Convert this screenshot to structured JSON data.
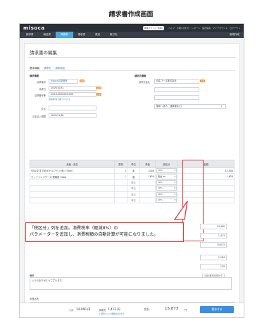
{
  "caption": "請求書作成画面",
  "app": {
    "logo": "misoca"
  },
  "topbar": {
    "period": "通常プラン(ご利用)",
    "links": [
      "ヘルプ",
      "お問い合わせ",
      "レポート",
      "設定情報",
      "マイアカウント",
      "ログアウト"
    ]
  },
  "nav": {
    "items": [
      "請求書",
      "納品書",
      "見積書",
      "領収書",
      "発送",
      "取引先"
    ],
    "active_index": 2,
    "right": "新規作成"
  },
  "page": {
    "title": "請求書の編集"
  },
  "tabs": [
    "基本情報",
    "請求先",
    "請求設定"
  ],
  "left": {
    "section": "請求情報",
    "invoice_no_label": "請求番号",
    "invoice_no_value": "Misoca請求番号",
    "invoice_date_label": "請求日",
    "invoice_date_value": "2019/10/31",
    "invoice_code_label": "請求番号等",
    "invoice_code_value": "XXX-XXXXXXXX-XXX",
    "code_note": "請求番号を自動で入力する",
    "subject_label": "件名",
    "subject_value": "",
    "due_label": "お支払い期限",
    "due_value": "2019/11/30",
    "required": "必須"
  },
  "right": {
    "section": "請求先情報",
    "client_label": "請求先会社",
    "client_value": "弥生フーズ株式会社",
    "dept_placeholder": "",
    "person_placeholder": "",
    "honorific_value": "御中（法人、団体様など）"
  },
  "table": {
    "headers": [
      "品番・品名",
      "数量",
      "単位",
      "単価",
      "税区分",
      "金額"
    ],
    "rows": [
      {
        "name": "9月のおすすめボトルワイン(赤) 750ml",
        "qty": "3",
        "unit": "本",
        "price": "4300",
        "tax": "10%",
        "amount": "12,900"
      },
      {
        "name": "モッツァレラチーズ 業務用 500g",
        "qty": "1",
        "unit": "個",
        "price": "1620",
        "tax": "軽減 8%",
        "amount": "1,620"
      },
      {
        "name": "",
        "qty": "",
        "unit": "単位",
        "price": "",
        "tax": "10%",
        "amount": "15,873"
      },
      {
        "name": "",
        "qty": "",
        "unit": "単位",
        "price": "",
        "tax": "10%",
        "amount": ""
      },
      {
        "name": "",
        "qty": "",
        "unit": "単位",
        "price": "",
        "tax": "10%",
        "amount": ""
      },
      {
        "name": "",
        "qty": "",
        "unit": "単位",
        "price": "",
        "tax": "10%",
        "amount": ""
      }
    ],
    "add_row": "行を追加（最大80行まで）"
  },
  "summary": {
    "subtotal": "14,460",
    "tax": "1,413",
    "total": "15,873",
    "label_tax": "消費税",
    "sub_a": "1,284",
    "sub_b": "129"
  },
  "callout": {
    "line1": "「税区分」列を追加。消費税率（軽減8%）の",
    "line2": "パラメーターを追加し、消費税額の自動計算が可能になりました。"
  },
  "notes": {
    "label": "備考",
    "value": "いつもありがとうございます。",
    "link": "以前の備考を参照する"
  },
  "bank": {
    "label": "お振込先",
    "value": "やよい銀行 休眠所支店（普）123456",
    "link": "口座の追加（お客様の口座を選択）"
  },
  "footer": {
    "subtotal_label": "小計",
    "subtotal": "14,460 円",
    "tax_label": "消費税",
    "tax": "1,413 円",
    "tax_note": "※ 税区分ごとの税額を表示する",
    "total_label": "合計",
    "total": "15,873",
    "yen": "円",
    "save": "保存する"
  }
}
